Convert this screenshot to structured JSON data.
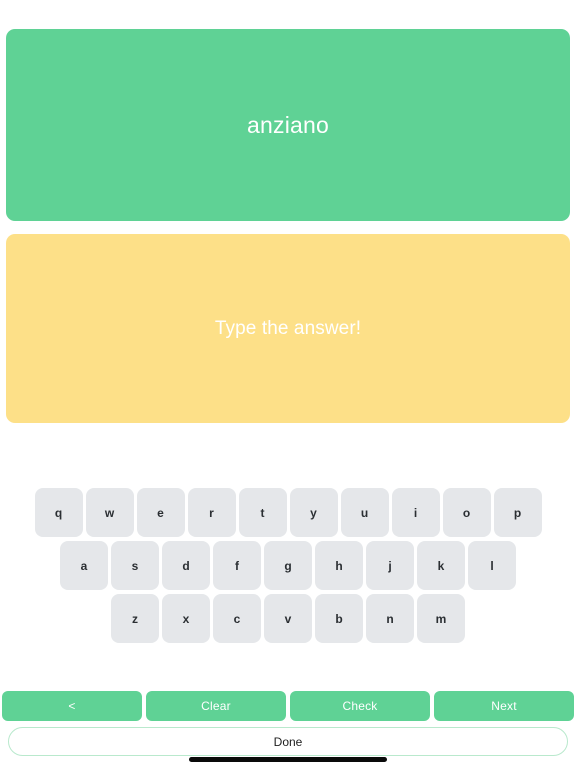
{
  "question_card": {
    "word": "anziano",
    "background_color": "#5fd295",
    "text_color": "#ffffff"
  },
  "answer_card": {
    "placeholder": "Type the answer!",
    "value": "",
    "background_color": "#fde088",
    "text_color": "#ffffff"
  },
  "keyboard": {
    "rows": [
      [
        "q",
        "w",
        "e",
        "r",
        "t",
        "y",
        "u",
        "i",
        "o",
        "p"
      ],
      [
        "a",
        "s",
        "d",
        "f",
        "g",
        "h",
        "j",
        "k",
        "l"
      ],
      [
        "z",
        "x",
        "c",
        "v",
        "b",
        "n",
        "m"
      ]
    ],
    "key_background": "#e5e7ea",
    "key_text_color": "#2b2f33"
  },
  "actions": {
    "back_label": "<",
    "clear_label": "Clear",
    "check_label": "Check",
    "next_label": "Next",
    "button_color": "#5fd295"
  },
  "done": {
    "label": "Done",
    "border_color": "#b9e9cd"
  }
}
